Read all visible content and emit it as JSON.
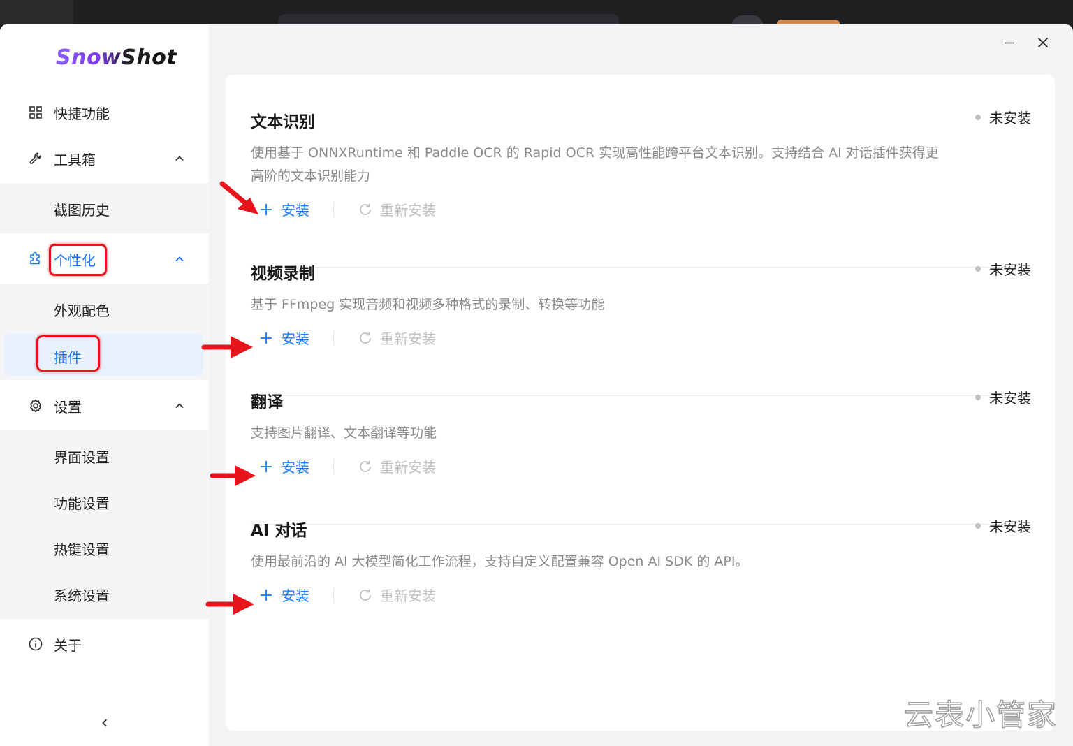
{
  "app": {
    "logo": "SnowShot",
    "collapse_icon": "chevron-left-icon"
  },
  "sidebar": {
    "items": [
      {
        "key": "quick",
        "label": "快捷功能",
        "icon": "grid-icon"
      },
      {
        "key": "tools",
        "label": "工具箱",
        "icon": "wrench-icon",
        "expanded": true,
        "children": [
          {
            "label": "截图历史"
          }
        ]
      },
      {
        "key": "personal",
        "label": "个性化",
        "icon": "puzzle-icon",
        "expanded": true,
        "children": [
          {
            "label": "外观配色"
          },
          {
            "label": "插件",
            "active": true
          }
        ]
      },
      {
        "key": "settings",
        "label": "设置",
        "icon": "gear-icon",
        "expanded": true,
        "children": [
          {
            "label": "界面设置"
          },
          {
            "label": "功能设置"
          },
          {
            "label": "热键设置"
          },
          {
            "label": "系统设置"
          }
        ]
      },
      {
        "key": "about",
        "label": "关于",
        "icon": "info-icon"
      }
    ]
  },
  "window_controls": {
    "minimize": "minimize-icon",
    "close": "close-icon"
  },
  "plugins": [
    {
      "title": "文本识别",
      "status": "未安装",
      "description": "使用基于 ONNXRuntime 和 Paddle OCR 的 Rapid OCR 实现高性能跨平台文本识别。支持结合 AI 对话插件获得更高阶的文本识别能力",
      "install_label": "安装",
      "reinstall_label": "重新安装"
    },
    {
      "title": "视频录制",
      "status": "未安装",
      "description": "基于 FFmpeg 实现音频和视频多种格式的录制、转换等功能",
      "install_label": "安装",
      "reinstall_label": "重新安装"
    },
    {
      "title": "翻译",
      "status": "未安装",
      "description": "支持图片翻译、文本翻译等功能",
      "install_label": "安装",
      "reinstall_label": "重新安装"
    },
    {
      "title": "AI 对话",
      "status": "未安装",
      "description": "使用最前沿的 AI 大模型简化工作流程，支持自定义配置兼容 Open AI SDK 的 API。",
      "install_label": "安装",
      "reinstall_label": "重新安装"
    }
  ],
  "colors": {
    "accent": "#1677ff",
    "annotation": "#e8141b",
    "logo_purple": "#8b5cf6"
  },
  "watermark": "云表小管家"
}
